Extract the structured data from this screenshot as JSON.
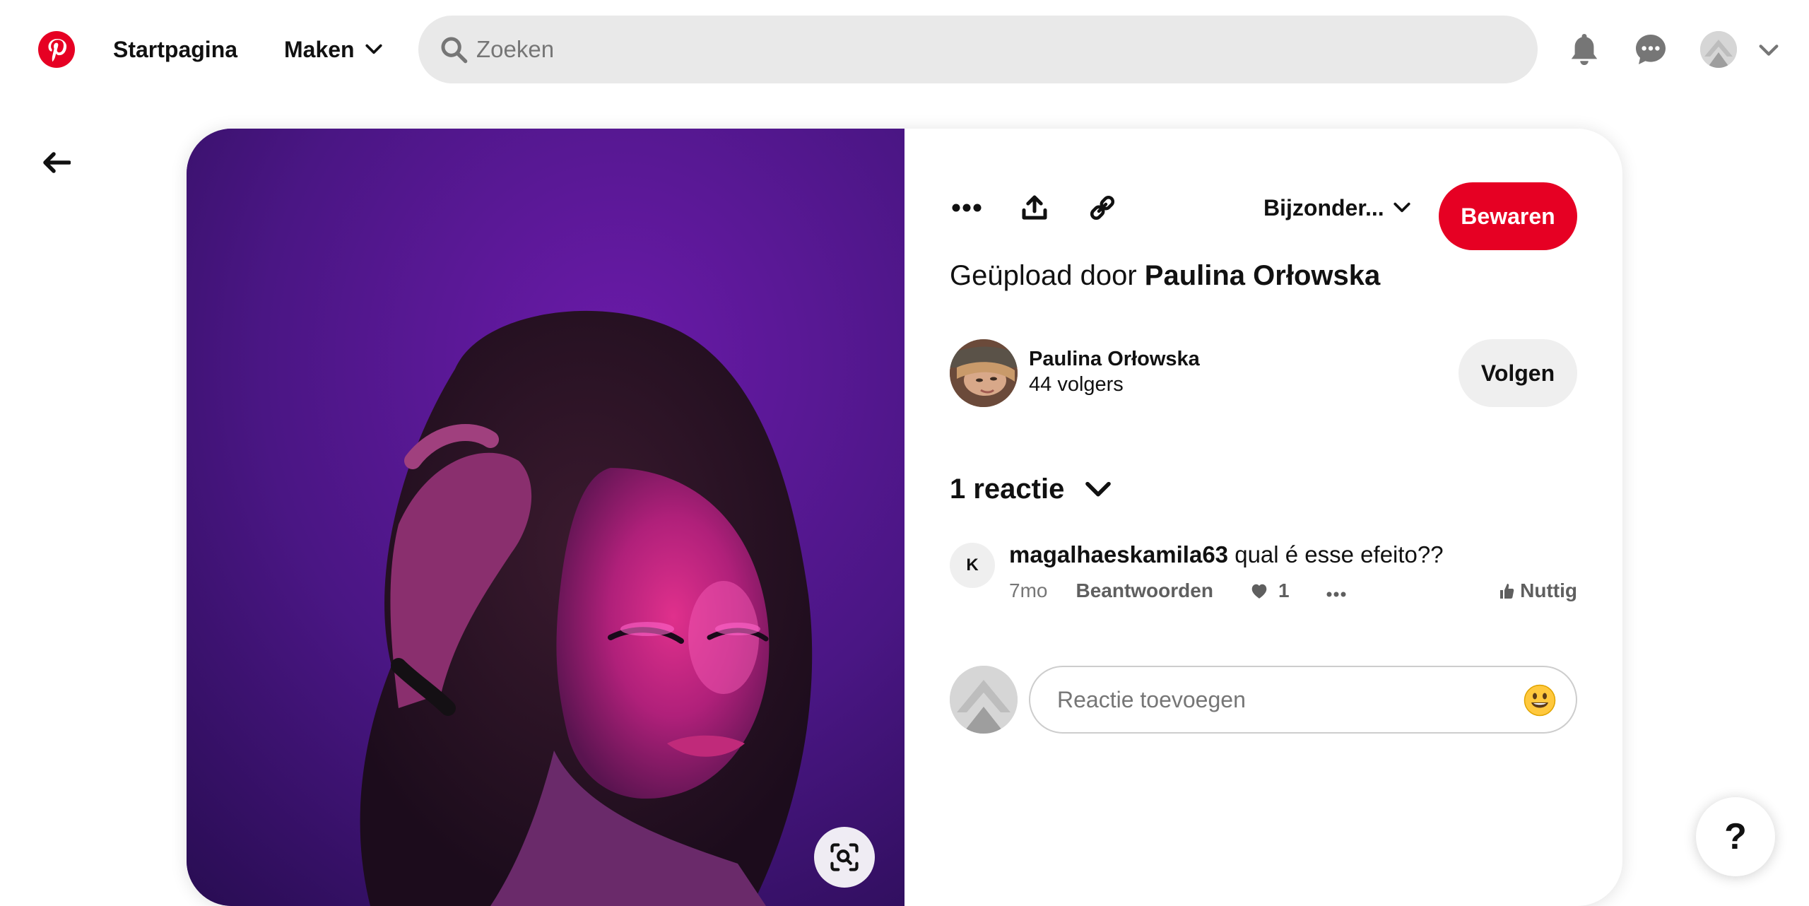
{
  "header": {
    "logo_icon": "pinterest-logo-icon",
    "home_label": "Startpagina",
    "create_label": "Maken",
    "search": {
      "placeholder": "Zoeken",
      "value": ""
    },
    "icons": [
      "notifications-bell-icon",
      "messages-icon",
      "account-avatar",
      "chevron-down-icon"
    ]
  },
  "colors": {
    "brand": "#e60023",
    "follow_bg": "#efefef",
    "search_bg": "#e9e9e9"
  },
  "pin": {
    "image_icon": "visual-search-icon",
    "toolbar": {
      "more_icon": "more-options-icon",
      "share_icon": "share-upload-icon",
      "link_icon": "copy-link-icon",
      "board_label": "Bijzonder...",
      "save_label": "Bewaren"
    },
    "uploaded_prefix": "Geüpload door",
    "uploaded_by": "Paulina Orłowska",
    "creator": {
      "name": "Paulina Orłowska",
      "followers": "44 volgers",
      "follow_label": "Volgen"
    },
    "comments": {
      "header": "1 reactie",
      "items": [
        {
          "avatar_letter": "K",
          "user": "magalhaeskamila63",
          "text": "qual é esse efeito??",
          "time": "7mo",
          "reply_label": "Beantwoorden",
          "likes": "1",
          "helpful_label": "Nuttig"
        }
      ]
    },
    "add_comment": {
      "placeholder": "Reactie toevoegen",
      "value": ""
    }
  },
  "help": {
    "label": "?"
  }
}
